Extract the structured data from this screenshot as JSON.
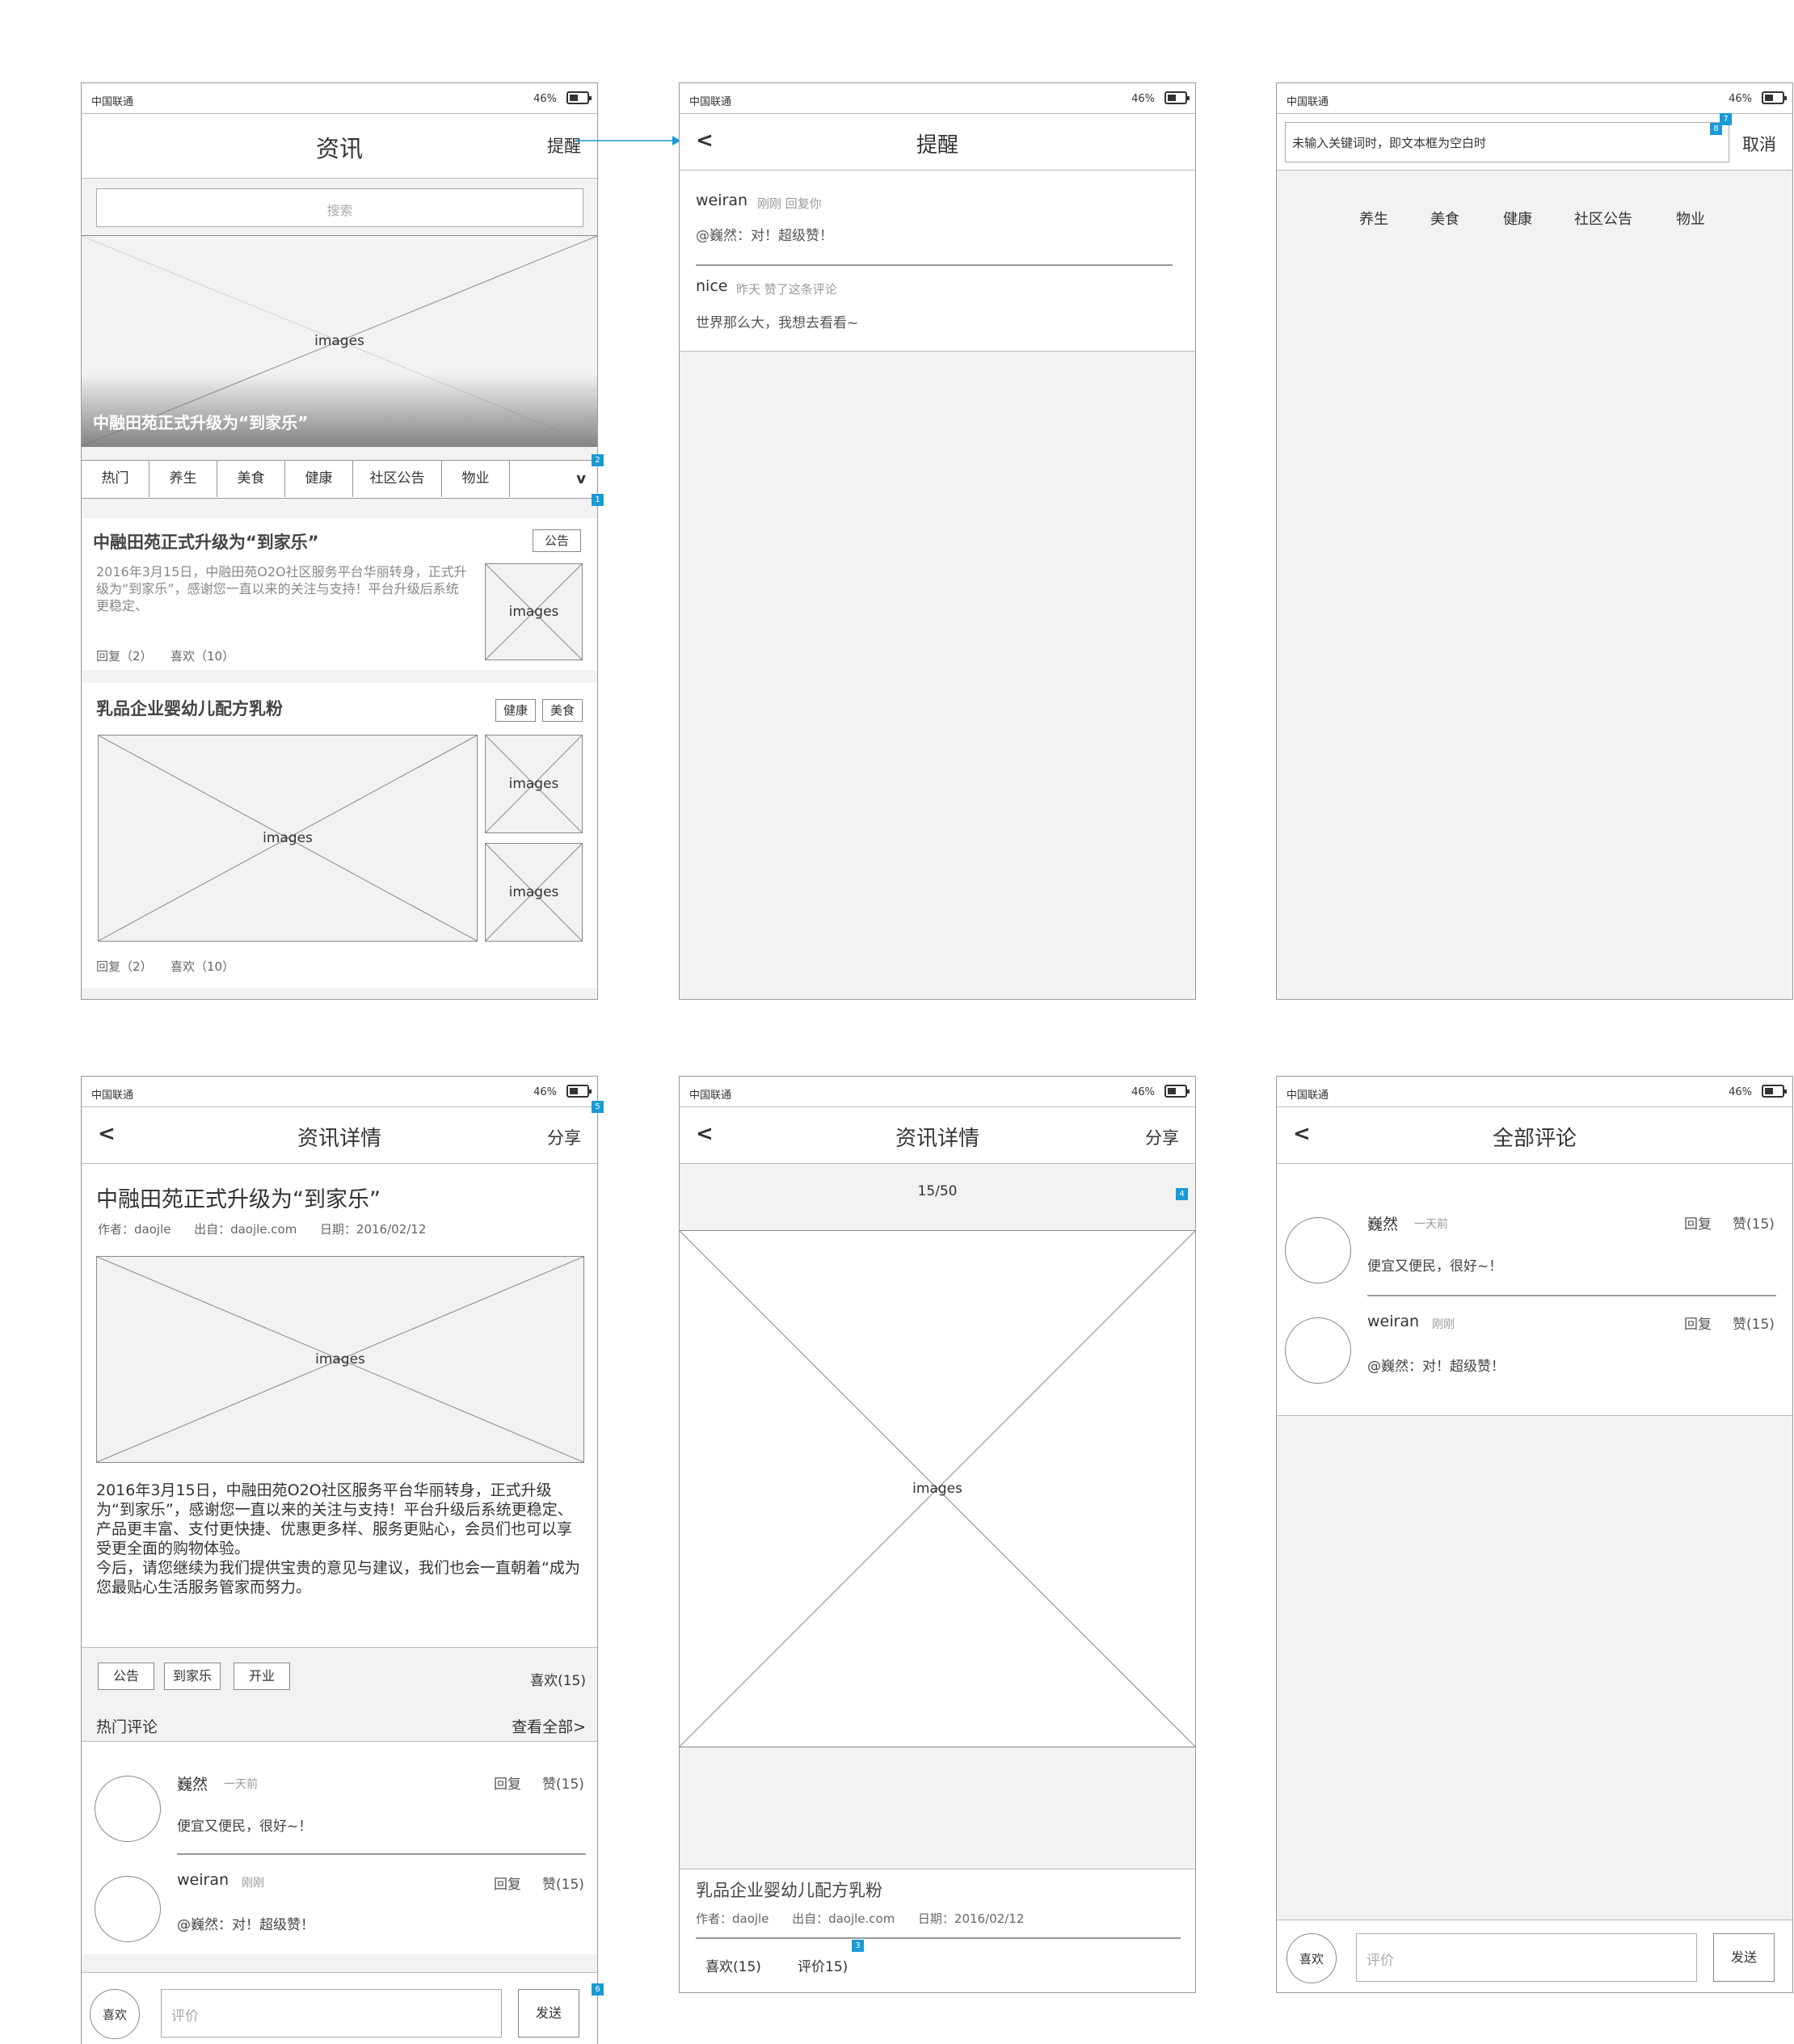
{
  "status": {
    "carrier": "中国联通",
    "battery": "46%"
  },
  "images_label": "images",
  "annotations": {
    "n1": "1",
    "n2": "2",
    "n3": "3",
    "n4": "4",
    "n5": "5",
    "n6": "6",
    "n7": "7",
    "n8": "8"
  },
  "screen1": {
    "title": "资讯",
    "remind": "提醒",
    "search_placeholder": "搜索",
    "banner_caption": "中融田苑正式升级为“到家乐”",
    "tabs": [
      "热门",
      "养生",
      "美食",
      "健康",
      "社区公告",
      "物业"
    ],
    "tabs_more": "v",
    "article1": {
      "title": "中融田苑正式升级为“到家乐”",
      "tag": "公告",
      "summary": "2016年3月15日，中融田苑O2O社区服务平台华丽转身，正式升级为“到家乐”，感谢您一直以来的关注与支持！平台升级后系统更稳定、",
      "reply": "回复（2）",
      "like": "喜欢（10）"
    },
    "article2": {
      "title": "乳品企业婴幼儿配方乳粉",
      "tags": [
        "健康",
        "美食"
      ],
      "reply": "回复（2）",
      "like": "喜欢（10）"
    }
  },
  "screen2": {
    "back": "<",
    "title": "提醒",
    "items": [
      {
        "user": "weiran",
        "meta": "刚刚 回复你",
        "text": "@巍然：对！超级赞！"
      },
      {
        "user": "nice",
        "meta": "昨天 赞了这条评论",
        "text": "世界那么大，我想去看看~"
      }
    ]
  },
  "screen3": {
    "search_value": "未输入关键词时，即文本框为空白时",
    "cancel": "取消",
    "categories": [
      "养生",
      "美食",
      "健康",
      "社区公告",
      "物业"
    ]
  },
  "screen4": {
    "back": "<",
    "title": "资讯详情",
    "share": "分享",
    "article_title": "中融田苑正式升级为“到家乐”",
    "meta": "作者：daojle      出自：daojle.com      日期：2016/02/12",
    "body": "2016年3月15日，中融田苑O2O社区服务平台华丽转身，正式升级为“到家乐”，感谢您一直以来的关注与支持！平台升级后系统更稳定、产品更丰富、支付更快捷、优惠更多样、服务更贴心，会员们也可以享受更全面的购物体验。\n今后，请您继续为我们提供宝贵的意见与建议，我们也会一直朝着“成为您最贴心生活服务管家而努力。",
    "tags": [
      "公告",
      "到家乐",
      "开业"
    ],
    "likes": "喜欢(15)",
    "hot_comments": "热门评论",
    "view_all": "查看全部>",
    "comments": [
      {
        "user": "巍然",
        "time": "一天前",
        "reply": "回复",
        "like": "赞(15)",
        "text": "便宜又便民，很好~！"
      },
      {
        "user": "weiran",
        "time": "刚刚",
        "reply": "回复",
        "like": "赞(15)",
        "text": "@巍然：对！超级赞！"
      }
    ],
    "like_btn": "喜欢",
    "input_placeholder": "评价",
    "send": "发送"
  },
  "screen5": {
    "back": "<",
    "title": "资讯详情",
    "share": "分享",
    "counter": "15/50",
    "article_title": "乳品企业婴幼儿配方乳粉",
    "meta": "作者：daojle      出自：daojle.com      日期：2016/02/12",
    "likes": "喜欢(15)",
    "reviews": "评价15)"
  },
  "screen6": {
    "back": "<",
    "title": "全部评论",
    "comments": [
      {
        "user": "巍然",
        "time": "一天前",
        "reply": "回复",
        "like": "赞(15)",
        "text": "便宜又便民，很好~！"
      },
      {
        "user": "weiran",
        "time": "刚刚",
        "reply": "回复",
        "like": "赞(15)",
        "text": "@巍然：对！超级赞！"
      }
    ],
    "like_btn": "喜欢",
    "input_placeholder": "评价",
    "send": "发送"
  }
}
